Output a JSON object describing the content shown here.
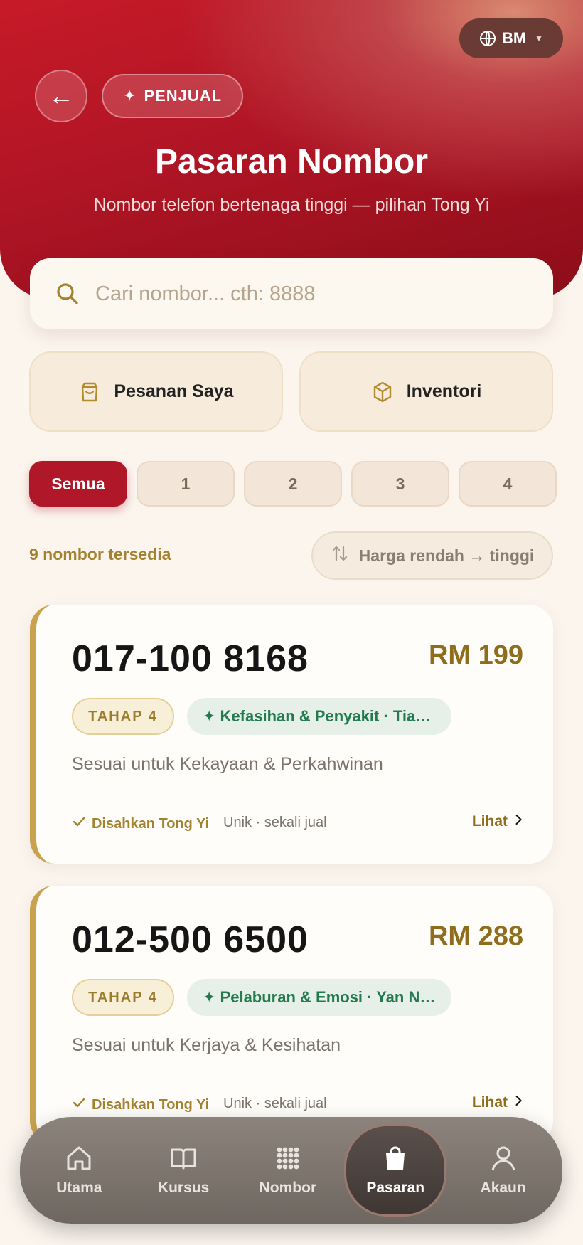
{
  "header": {
    "language": "BM",
    "seller_label": "PENJUAL",
    "title": "Pasaran Nombor",
    "subtitle": "Nombor telefon bertenaga tinggi — pilihan Tong Yi"
  },
  "search": {
    "placeholder": "Cari nombor... cth: 8888",
    "value": ""
  },
  "quick_actions": {
    "orders": "Pesanan Saya",
    "inventory": "Inventori"
  },
  "filters": {
    "tabs": [
      "Semua",
      "1",
      "2",
      "3",
      "4"
    ],
    "selected": "Semua"
  },
  "results": {
    "count_label": "9 nombor tersedia",
    "sort_label": "Harga rendah → tinggi"
  },
  "listings": [
    {
      "number": "017-100 8168",
      "price": "RM 199",
      "level": "TAHAP 4",
      "tag": "✦ Kefasihan & Penyakit · Tian Yi",
      "description": "Sesuai untuk Kekayaan & Perkahwinan",
      "verified": "Disahkan Tong Yi",
      "unique": "Unik · sekali jual",
      "view": "Lihat"
    },
    {
      "number": "012-500 6500",
      "price": "RM 288",
      "level": "TAHAP 4",
      "tag": "✦ Pelaburan & Emosi · Yan Nian",
      "description": "Sesuai untuk Kerjaya & Kesihatan",
      "verified": "Disahkan Tong Yi",
      "unique": "Unik · sekali jual",
      "view": "Lihat"
    }
  ],
  "nav": {
    "items": [
      {
        "label": "Utama",
        "icon": "home-icon"
      },
      {
        "label": "Kursus",
        "icon": "book-icon"
      },
      {
        "label": "Nombor",
        "icon": "grid-dots-icon"
      },
      {
        "label": "Pasaran",
        "icon": "shopping-bag-icon"
      },
      {
        "label": "Akaun",
        "icon": "user-icon"
      }
    ],
    "active": "Pasaran"
  },
  "colors": {
    "primary": "#b0182a",
    "gold": "#a3822f",
    "green": "#237a4e",
    "background": "#fbf5ee"
  }
}
